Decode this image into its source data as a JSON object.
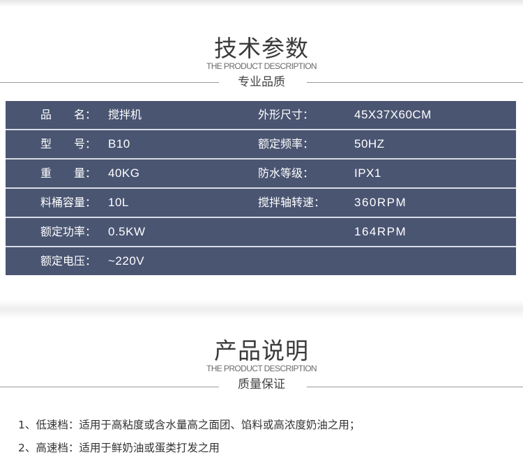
{
  "spec_section": {
    "title": "技术参数",
    "subtitle_en": "THE PRODUCT DESCRIPTION",
    "subtitle_cn": "专业品质"
  },
  "spec_rows": [
    {
      "label1": "品　　名：",
      "value1": "搅拌机",
      "label2": "外形尺寸：",
      "value2": "45X37X60CM"
    },
    {
      "label1": "型　　号：",
      "value1": "B10",
      "label2": "额定频率：",
      "value2": "50HZ"
    },
    {
      "label1": "重　　量：",
      "value1": "40KG",
      "label2": "防水等级：",
      "value2": "IPX1"
    },
    {
      "label1": "料桶容量：",
      "value1": "10L",
      "label2": "搅拌轴转速：",
      "value2": "360RPM"
    },
    {
      "label1": "额定功率：",
      "value1": "0.5KW",
      "label2": "",
      "value2": "164RPM"
    },
    {
      "label1": "额定电压：",
      "value1": "~220V",
      "label2": "",
      "value2": ""
    }
  ],
  "desc_section": {
    "title": "产品说明",
    "subtitle_en": "THE PRODUCT DESCRIPTION",
    "subtitle_cn": "质量保证"
  },
  "desc_lines": [
    "1、低速档：适用于高粘度或含水量高之面团、馅料或高浓度奶油之用；",
    "2、高速档：适用于鲜奶油或蛋类打发之用"
  ],
  "colors": {
    "table_bg": "#4a5572",
    "row_divider": "#d9dde6"
  }
}
